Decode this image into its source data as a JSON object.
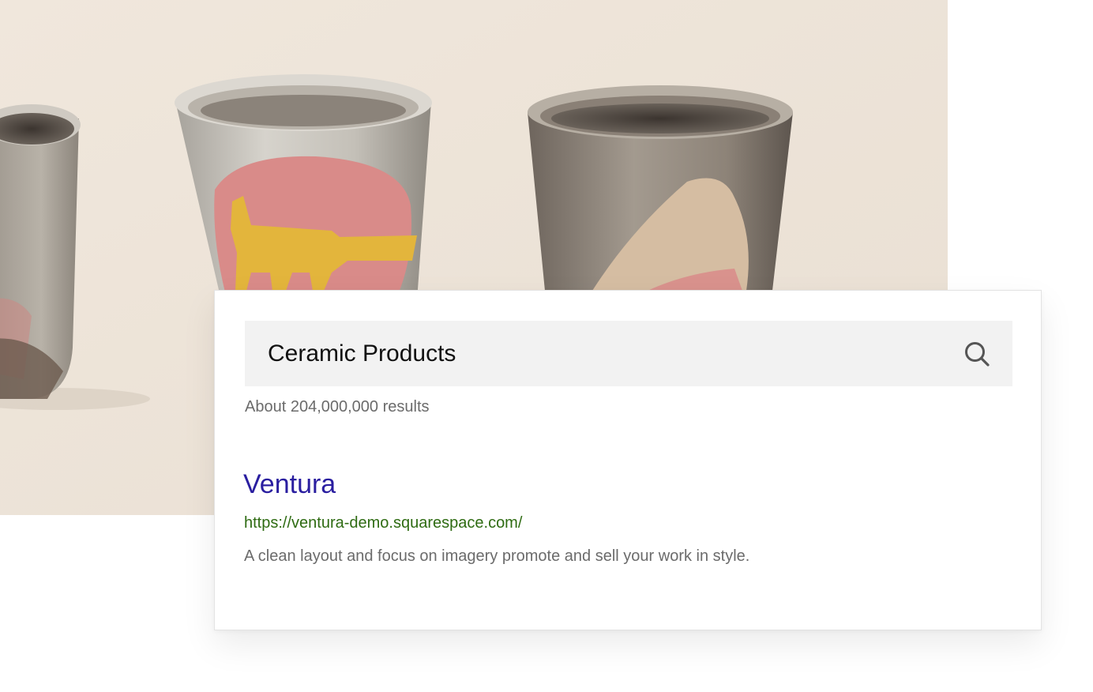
{
  "search": {
    "query": "Ceramic Products",
    "result_count": "About 204,000,000 results"
  },
  "result": {
    "title": "Ventura",
    "url": "https://ventura-demo.squarespace.com/",
    "snippet": "A clean layout and focus on imagery promote and sell your work in style."
  },
  "colors": {
    "photo_background": "#ede4d9",
    "search_bar_background": "#f2f2f2",
    "title_link": "#2a1ea0",
    "url_green": "#2e6b12",
    "muted_text": "#6b6b6b"
  }
}
